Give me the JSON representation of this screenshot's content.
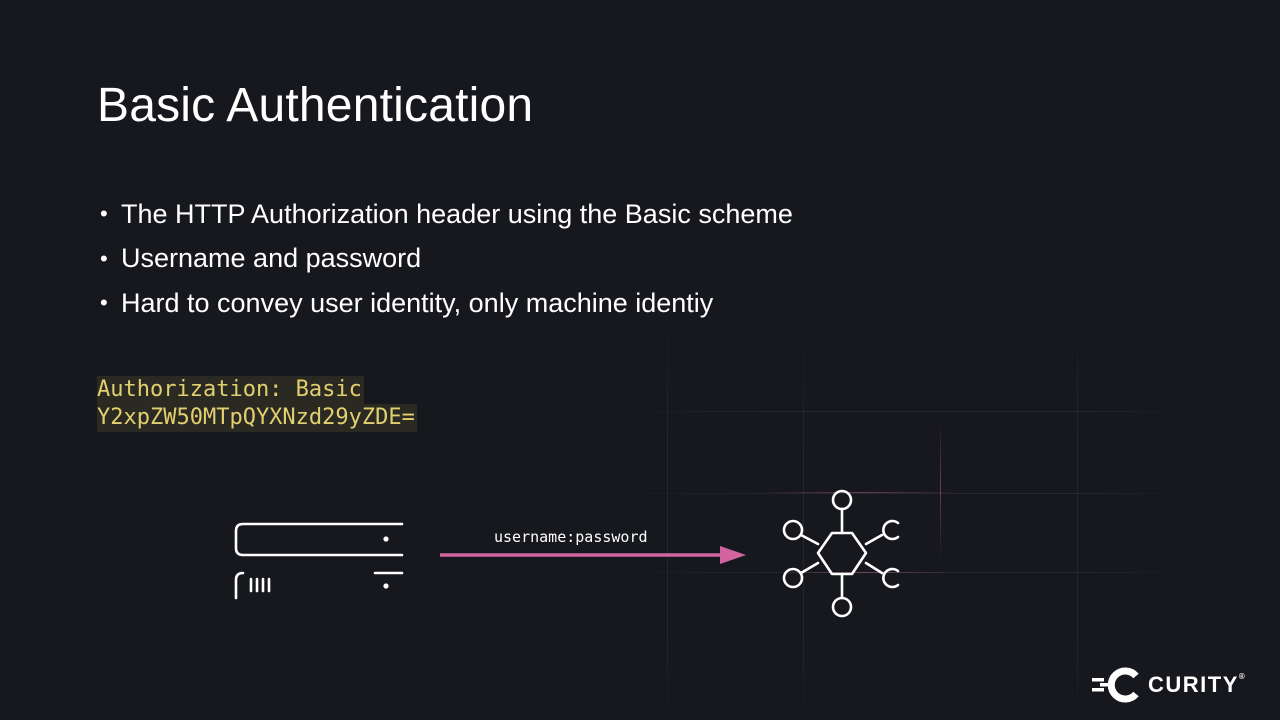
{
  "slide": {
    "title": "Basic Authentication",
    "bullets": [
      "The HTTP Authorization header using the Basic scheme",
      "Username and password",
      "Hard to convey user identity, only machine identiy"
    ],
    "bullet_glyph": "•",
    "code_lines": [
      "Authorization: Basic",
      "Y2xpZW50MTpQYXNzd29yZDE="
    ],
    "arrow_label": "username:password"
  },
  "diagram": {
    "client_icon": "server-icon",
    "api_icon": "api-hexagon-icon",
    "arrow_color": "#d4649f"
  },
  "branding": {
    "logo_icon": "curity-logo-icon",
    "logo_text": "CURITY",
    "registered_mark": "®"
  },
  "colors": {
    "background": "#17181d",
    "code_text": "#e2cf6f",
    "code_highlight": "#2b2a22",
    "accent": "#d4649f"
  }
}
